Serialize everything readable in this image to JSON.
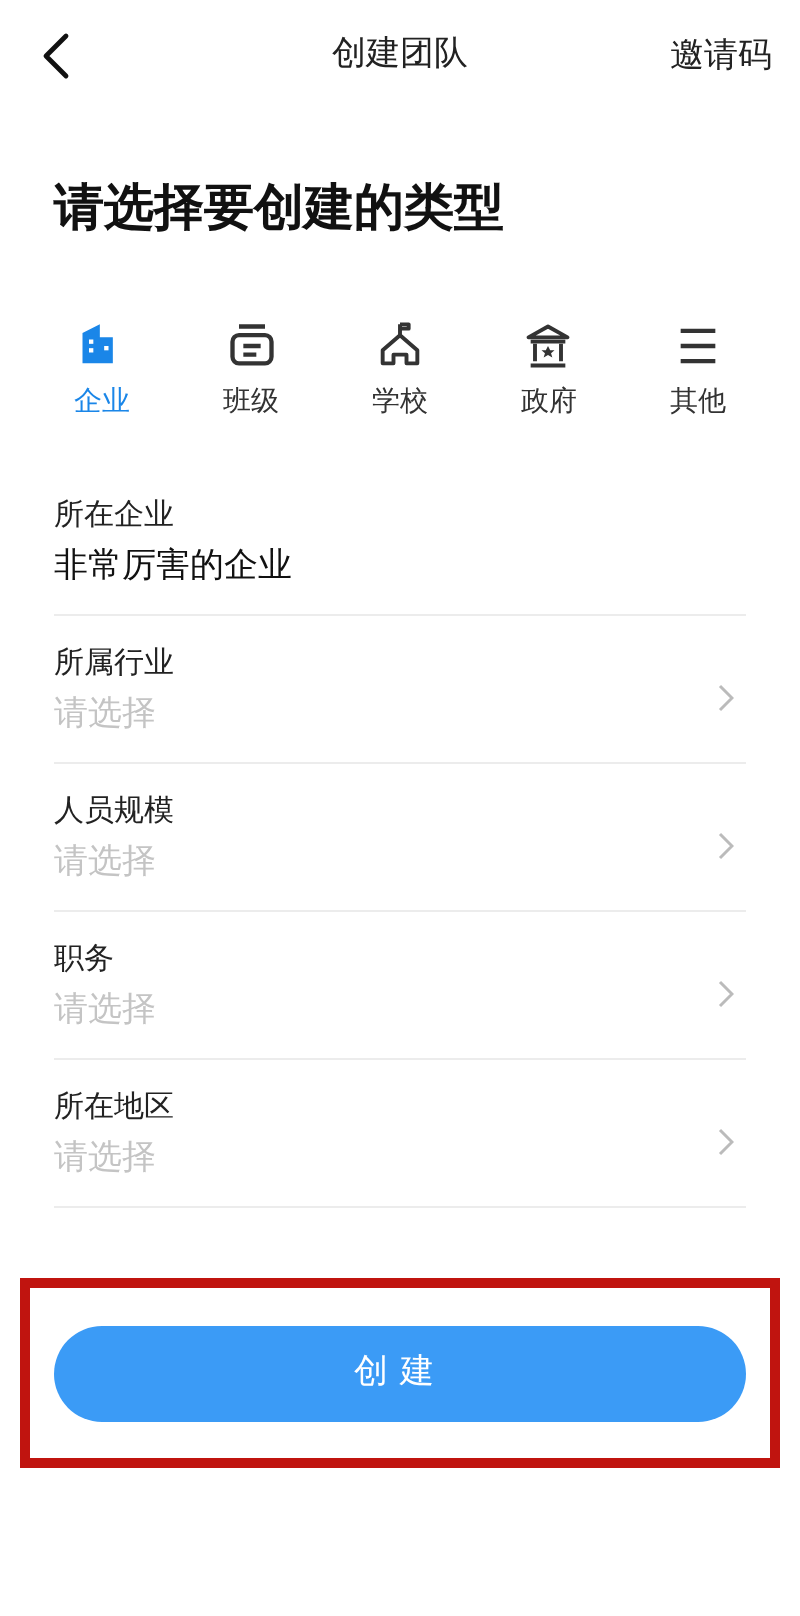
{
  "header": {
    "title": "创建团队",
    "action": "邀请码"
  },
  "heading": "请选择要创建的类型",
  "types": [
    {
      "label": "企业",
      "selected": true
    },
    {
      "label": "班级",
      "selected": false
    },
    {
      "label": "学校",
      "selected": false
    },
    {
      "label": "政府",
      "selected": false
    },
    {
      "label": "其他",
      "selected": false
    }
  ],
  "fields": [
    {
      "kind": "text",
      "label": "所在企业",
      "value": "非常厉害的企业"
    },
    {
      "kind": "select",
      "label": "所属行业",
      "placeholder": "请选择"
    },
    {
      "kind": "select",
      "label": "人员规模",
      "placeholder": "请选择"
    },
    {
      "kind": "select",
      "label": "职务",
      "placeholder": "请选择"
    },
    {
      "kind": "select",
      "label": "所在地区",
      "placeholder": "请选择"
    }
  ],
  "submit": {
    "label": "创建",
    "highlighted": true
  }
}
